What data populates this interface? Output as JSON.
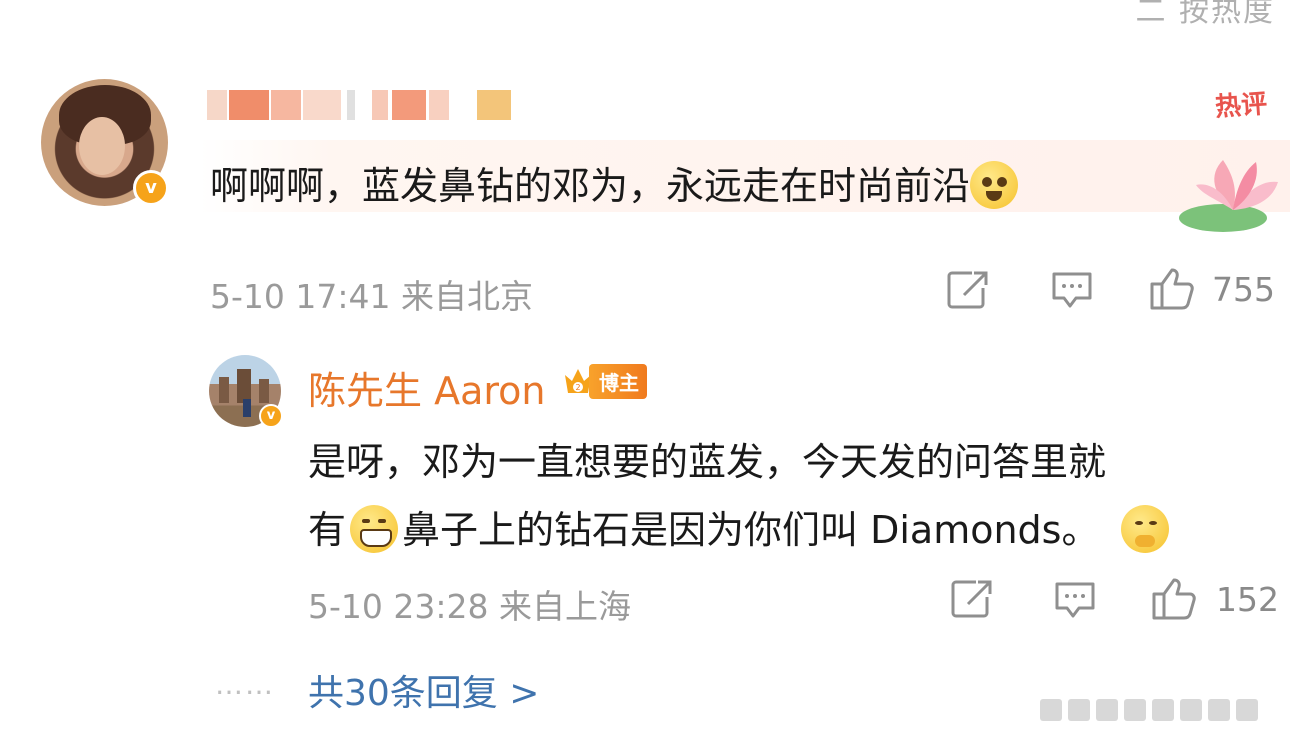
{
  "header": {
    "sort_label": "二 按热度"
  },
  "comment": {
    "tag": "热评",
    "text": "啊啊啊，蓝发鼻钻的邓为，永远走在时尚前沿",
    "date": "5-10 17:41",
    "location": "来自北京",
    "likes": "755",
    "icons": [
      "share-icon",
      "comment-icon",
      "like-icon"
    ]
  },
  "reply": {
    "author": "陈先生 Aaron",
    "badge": "博主",
    "text_line1": "是呀，邓为一直想要的蓝发，今天发的问答里就",
    "text_line2_a": "有",
    "text_line2_b": "鼻子上的钻石是因为你们叫 Diamonds。",
    "date": "5-10 23:28",
    "location": "来自上海",
    "likes": "152"
  },
  "footer": {
    "more_dots": "……",
    "more_replies": "共30条回复 >"
  },
  "colors": {
    "accent_orange": "#e7772b",
    "link_blue": "#3f73ad",
    "hot_red": "#e8544d",
    "meta_gray": "#9a9a9a"
  }
}
